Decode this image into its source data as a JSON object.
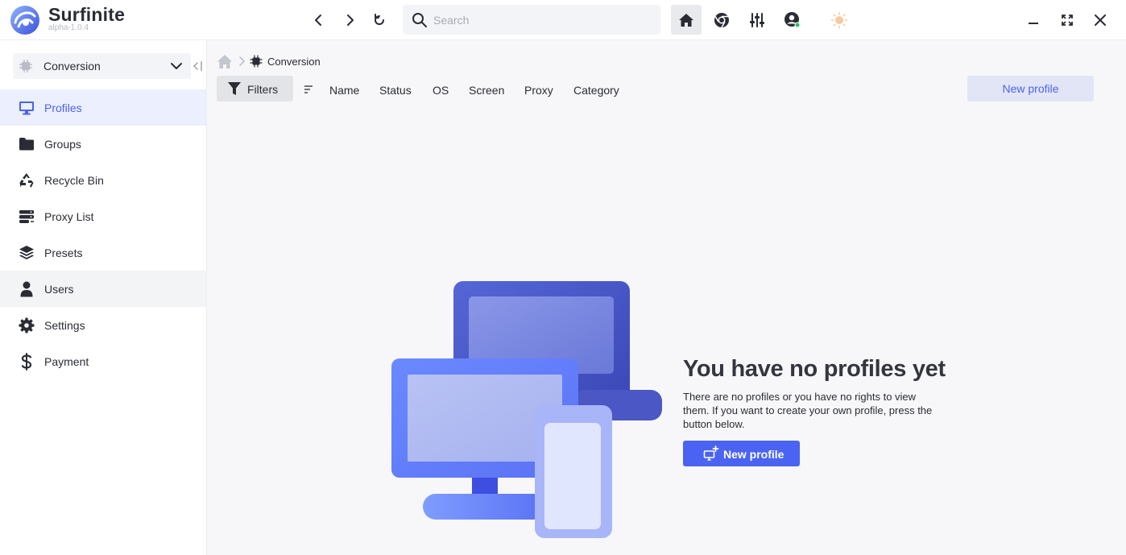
{
  "app": {
    "name": "Surfinite",
    "version": "alpha-1.0.4"
  },
  "toolbar": {
    "search_placeholder": "Search"
  },
  "workspace": {
    "selected": "Conversion"
  },
  "sidebar": {
    "items": [
      {
        "label": "Profiles",
        "icon": "monitor-icon"
      },
      {
        "label": "Groups",
        "icon": "folder-icon"
      },
      {
        "label": "Recycle Bin",
        "icon": "recycle-icon"
      },
      {
        "label": "Proxy List",
        "icon": "server-icon"
      },
      {
        "label": "Presets",
        "icon": "layers-icon"
      },
      {
        "label": "Users",
        "icon": "user-icon"
      },
      {
        "label": "Settings",
        "icon": "gear-icon"
      },
      {
        "label": "Payment",
        "icon": "dollar-icon"
      }
    ]
  },
  "breadcrumb": {
    "current": "Conversion"
  },
  "filters": {
    "label": "Filters",
    "columns": [
      "Name",
      "Status",
      "OS",
      "Screen",
      "Proxy",
      "Category"
    ]
  },
  "actions": {
    "new_profile_top": "New profile",
    "new_profile_main": "New profile"
  },
  "empty_state": {
    "title": "You have no profiles yet",
    "description": "There are no profiles or you have no rights to view them. If you want to create your own profile, press the button below."
  },
  "colors": {
    "accent": "#4a63f2",
    "active_bg": "#eceffd",
    "status_online": "#22c55e",
    "theme_sun": "#f8c9a0"
  }
}
